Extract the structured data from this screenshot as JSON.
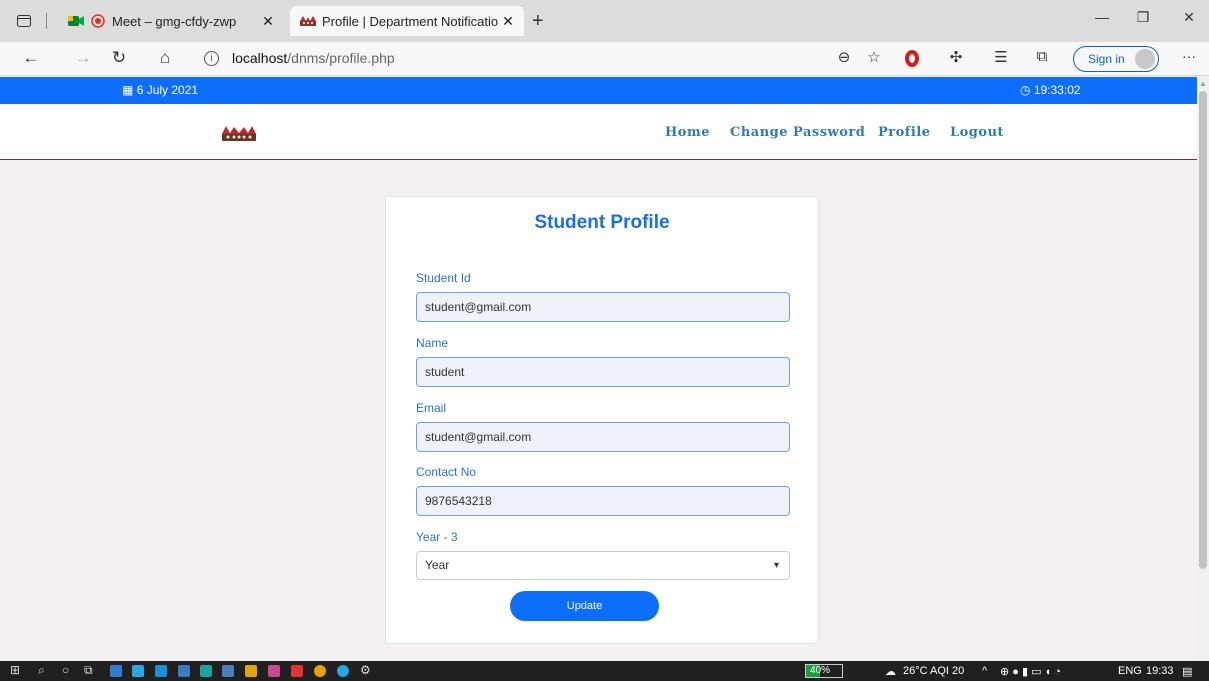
{
  "browser": {
    "tabs": [
      {
        "title": "Meet – gmg-cfdy-zwp",
        "active": false,
        "icon": "meet-icon"
      },
      {
        "title": "Profile | Department Notification",
        "active": true,
        "icon": "crown-logo-icon"
      }
    ],
    "new_tab": "+",
    "url_host": "localhost",
    "url_path": "/dnms/profile.php",
    "sign_in": "Sign in",
    "more": "···"
  },
  "site": {
    "date": "6 July 2021",
    "time": "19:33:02",
    "nav": [
      "Home",
      "Change Password",
      "Profile",
      "Logout"
    ],
    "accent": "#0d6efd"
  },
  "profile": {
    "title": "Student Profile",
    "fields": [
      {
        "label": "Student Id",
        "value": "student@gmail.com"
      },
      {
        "label": "Name",
        "value": "student"
      },
      {
        "label": "Email",
        "value": "student@gmail.com"
      },
      {
        "label": "Contact No",
        "value": "9876543218"
      }
    ],
    "year_label": "Year - 3",
    "year_selected": "Year",
    "submit": "Update"
  },
  "taskbar": {
    "battery": "40%",
    "battery_level": 0.4,
    "weather": "26°C AQI 20",
    "lang": "ENG",
    "clock": "19:33"
  }
}
